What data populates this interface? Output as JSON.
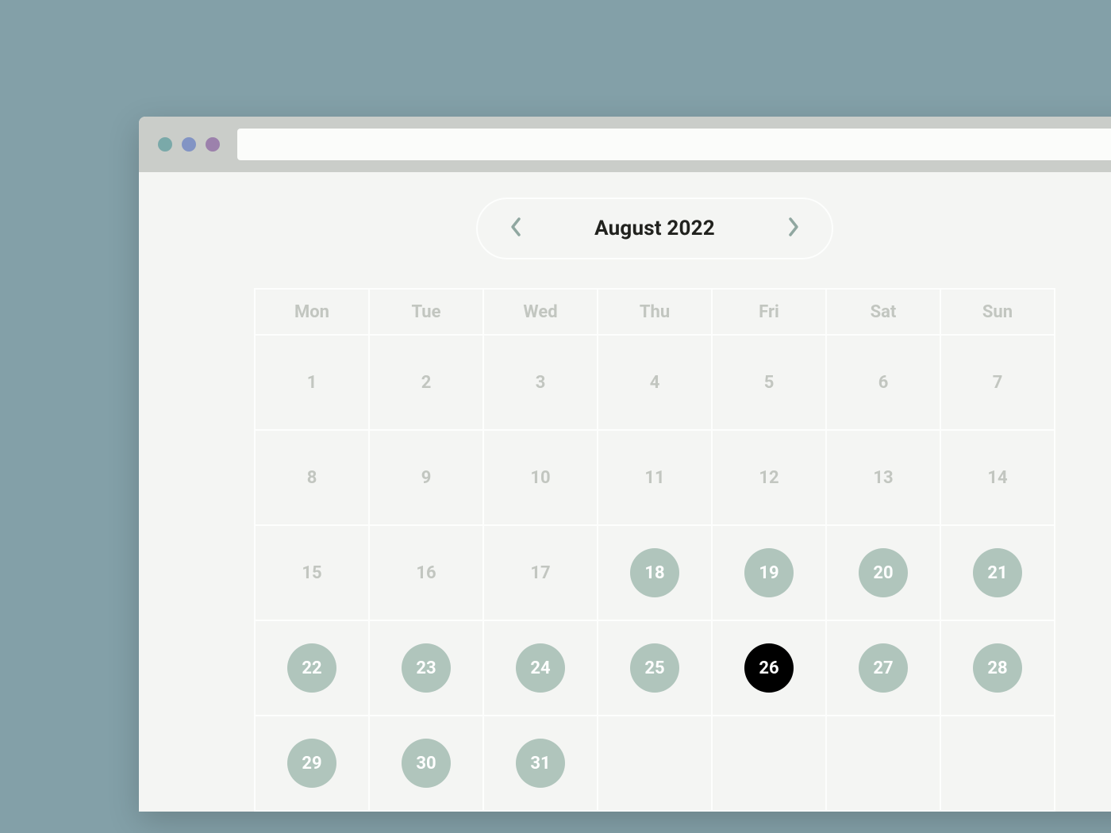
{
  "month_label": "August 2022",
  "weekdays": [
    "Mon",
    "Tue",
    "Wed",
    "Thu",
    "Fri",
    "Sat",
    "Sun"
  ],
  "weeks": [
    [
      {
        "n": 1
      },
      {
        "n": 2
      },
      {
        "n": 3
      },
      {
        "n": 4
      },
      {
        "n": 5
      },
      {
        "n": 6
      },
      {
        "n": 7
      }
    ],
    [
      {
        "n": 8
      },
      {
        "n": 9
      },
      {
        "n": 10
      },
      {
        "n": 11
      },
      {
        "n": 12
      },
      {
        "n": 13
      },
      {
        "n": 14
      }
    ],
    [
      {
        "n": 15
      },
      {
        "n": 16
      },
      {
        "n": 17
      },
      {
        "n": 18,
        "hl": true
      },
      {
        "n": 19,
        "hl": true
      },
      {
        "n": 20,
        "hl": true
      },
      {
        "n": 21,
        "hl": true
      }
    ],
    [
      {
        "n": 22,
        "hl": true
      },
      {
        "n": 23,
        "hl": true
      },
      {
        "n": 24,
        "hl": true
      },
      {
        "n": 25,
        "hl": true
      },
      {
        "n": 26,
        "sel": true
      },
      {
        "n": 27,
        "hl": true
      },
      {
        "n": 28,
        "hl": true
      }
    ],
    [
      {
        "n": 29,
        "hl": true
      },
      {
        "n": 30,
        "hl": true
      },
      {
        "n": 31,
        "hl": true
      },
      {
        "n": null
      },
      {
        "n": null
      },
      {
        "n": null
      },
      {
        "n": null
      }
    ]
  ],
  "colors": {
    "page_bg": "#83a0a8",
    "window_bg": "#f4f5f3",
    "chrome_bg": "#cacdc9",
    "grid_border": "#fdfefd",
    "muted_text": "#c2c6c0",
    "chevron": "#90a7a0",
    "highlight_chip": "#b0c5bc",
    "selected_chip": "#000000",
    "dot_teal": "#7aa9a9",
    "dot_blue": "#8294c4",
    "dot_purple": "#9c81ac"
  }
}
